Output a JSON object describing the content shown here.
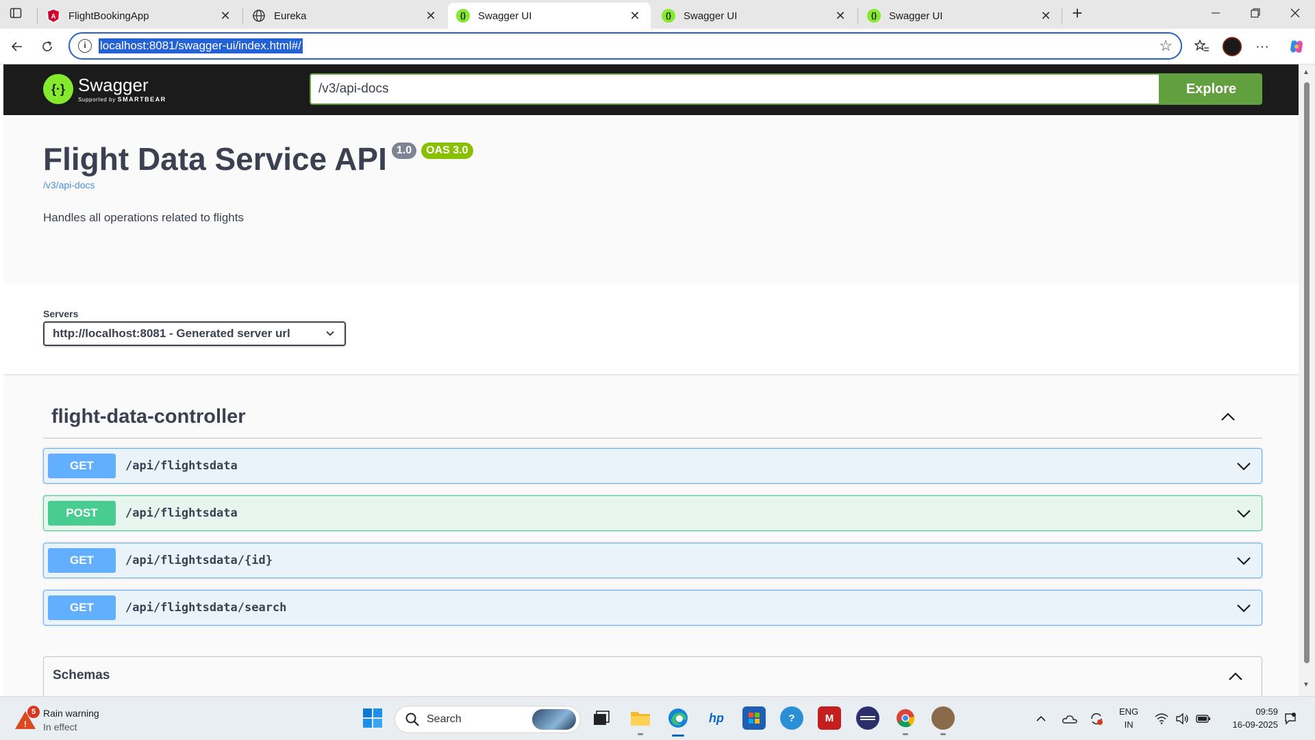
{
  "browser": {
    "tabs": [
      {
        "label": "FlightBookingApp",
        "icon": "angular-icon",
        "active": false
      },
      {
        "label": "Eureka",
        "icon": "globe-icon",
        "active": false
      },
      {
        "label": "Swagger UI",
        "icon": "swagger-icon",
        "active": true
      },
      {
        "label": "Swagger UI",
        "icon": "swagger-icon",
        "active": false
      },
      {
        "label": "Swagger UI",
        "icon": "swagger-icon",
        "active": false
      }
    ],
    "address": "localhost:8081/swagger-ui/index.html#/",
    "accent_color": "#2164c5"
  },
  "swagger": {
    "brand": "Swagger",
    "brand_sub_prefix": "Supported by",
    "brand_sub_company": "SMARTBEAR",
    "spec_url_input": "/v3/api-docs",
    "explore_label": "Explore",
    "title": "Flight Data Service API",
    "version_badge": "1.0",
    "oas_badge": "OAS 3.0",
    "spec_link": "/v3/api-docs",
    "description": "Handles all operations related to flights",
    "servers_label": "Servers",
    "server_selected": "http://localhost:8081 - Generated server url",
    "tag": "flight-data-controller",
    "operations": [
      {
        "method": "GET",
        "path": "/api/flightsdata",
        "color": "#61affe"
      },
      {
        "method": "POST",
        "path": "/api/flightsdata",
        "color": "#49cc90"
      },
      {
        "method": "GET",
        "path": "/api/flightsdata/{id}",
        "color": "#61affe"
      },
      {
        "method": "GET",
        "path": "/api/flightsdata/search",
        "color": "#61affe"
      }
    ],
    "schemas_label": "Schemas"
  },
  "taskbar": {
    "weather_badge": "5",
    "weather_title": "Rain warning",
    "weather_sub": "In effect",
    "search_label": "Search",
    "lang_top": "ENG",
    "lang_bottom": "IN",
    "time": "09:59",
    "date": "16-09-2025"
  }
}
